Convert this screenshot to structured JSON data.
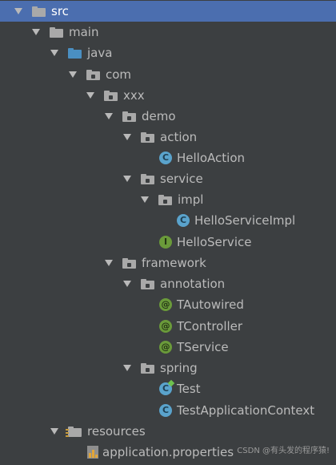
{
  "tree": {
    "src": "src",
    "main": "main",
    "java": "java",
    "com": "com",
    "xxx": "xxx",
    "demo": "demo",
    "action": "action",
    "hello_action": "HelloAction",
    "service": "service",
    "impl": "impl",
    "hello_service_impl": "HelloServiceImpl",
    "hello_service": "HelloService",
    "framework": "framework",
    "annotation": "annotation",
    "tautowired": "TAutowired",
    "tcontroller": "TController",
    "tservice": "TService",
    "spring": "spring",
    "test": "Test",
    "test_application_context": "TestApplicationContext",
    "resources": "resources",
    "application_properties": "application.properties"
  },
  "icons": {
    "class_badge": "C",
    "interface_badge": "I",
    "annotation_badge": "@"
  },
  "watermark": "CSDN @有头发的程序猿!",
  "colors": {
    "background": "#3c3f41",
    "selection": "#4b6eaf",
    "text": "#bbbbbb",
    "source_folder": "#4a8fc2",
    "class_icon": "#5aa3cc",
    "interface_icon": "#6a9a3a"
  }
}
